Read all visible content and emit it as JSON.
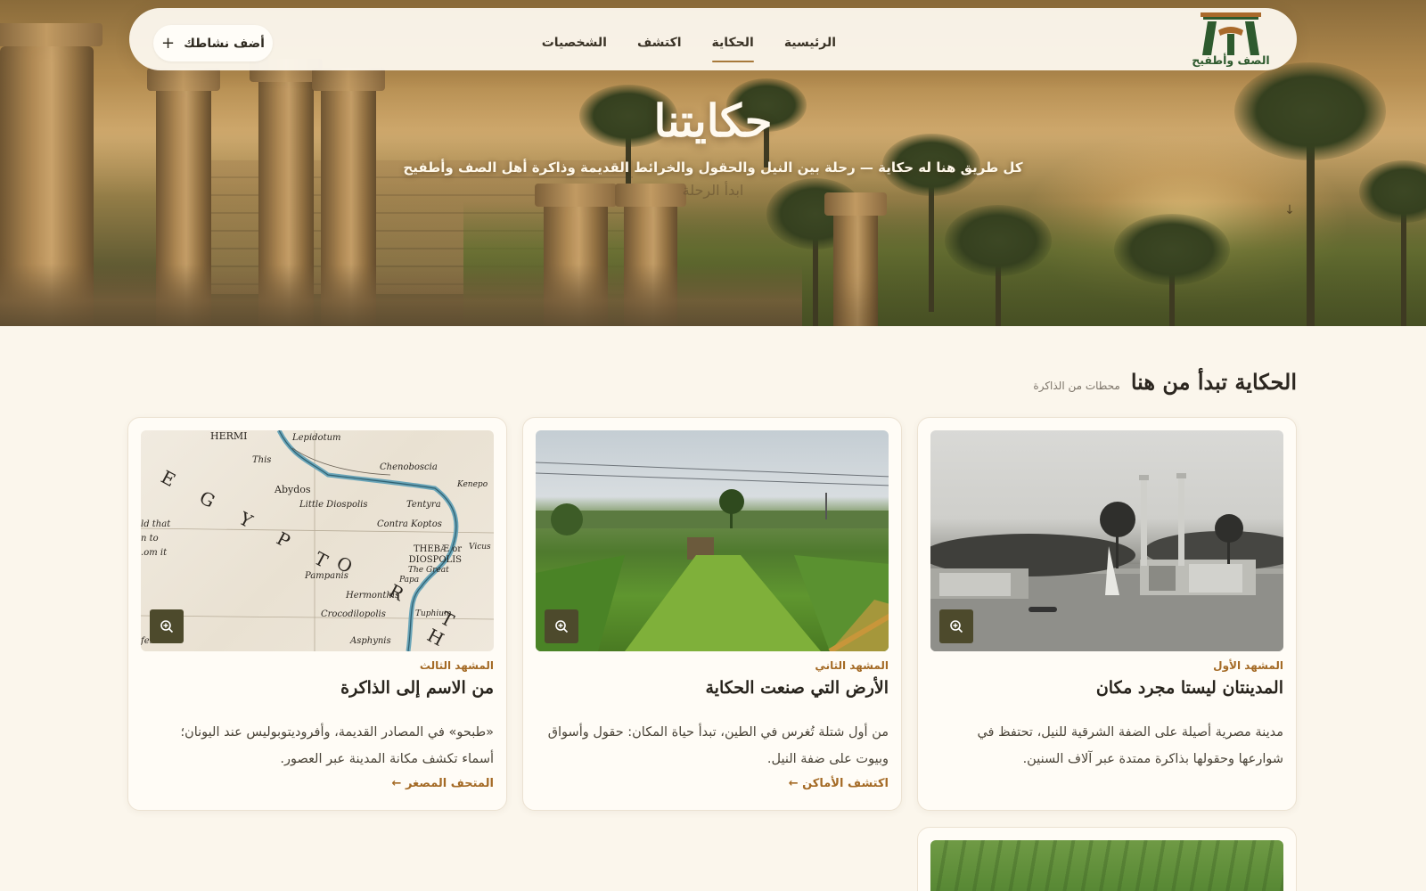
{
  "nav": {
    "logo_text": "الصف وأطفيح",
    "links": [
      {
        "label": "الرئيسية"
      },
      {
        "label": "الحكاية"
      },
      {
        "label": "اكتشف"
      },
      {
        "label": "الشخصيات"
      }
    ],
    "active_index": 1,
    "add_button": "أضف نشاطك"
  },
  "hero": {
    "title": "حكايتنا",
    "subtitle": "كل طريق هنا له حكاية — رحلة بين النيل والحقول والخرائط القديمة وذاكرة أهل الصف وأطفيح",
    "cta": "ابدأ الرحلة"
  },
  "section": {
    "title": "الحكاية تبدأ من هنا",
    "subtitle": "محطات من الذاكرة"
  },
  "cards": [
    {
      "kicker": "المشهد الأول",
      "title": "المدينتان ليستا مجرد مكان",
      "description": "مدينة مصرية أصيلة على الضفة الشرقية للنيل، تحتفظ في شوارعها وحقولها بذاكرة ممتدة عبر آلاف السنين.",
      "link": ""
    },
    {
      "kicker": "المشهد الثاني",
      "title": "الأرض التي صنعت الحكاية",
      "description": "من أول شتلة تُغرس في الطين، تبدأ حياة المكان: حقول وأسواق وبيوت على ضفة النيل.",
      "link": "اكتشف الأماكن ←"
    },
    {
      "kicker": "المشهد الثالث",
      "title": "من الاسم إلى الذاكرة",
      "description": "«طبحو» في المصادر القديمة، وأفروديتوبوليس عند اليونان؛ أسماء تكشف مكانة المدينة عبر العصور.",
      "link": "المتحف المصغر ←"
    }
  ],
  "map_labels": {
    "egypt": "E G Y P T",
    "north": "O R T H",
    "thebes": "THEBÆ or DIOSPOLIS",
    "thebes2": "The Great",
    "abydos": "Abydos",
    "lepidotum": "Lepidotum",
    "chenoboscia": "Chenoboscia",
    "little_diospolis": "Little Diospolis",
    "tentyra": "Tentyra",
    "contra_koptos": "Contra Koptos",
    "hermonthis": "Hermonthis",
    "crocodilopolis": "Crocodilopolis",
    "pampanis": "Pampanis",
    "papa": "Papa",
    "tuphium": "Tuphium",
    "asphynis": "Asphynis",
    "hermi": "HERMI",
    "this": "This",
    "kenepo": "Kenepo",
    "vicus": "Vicus",
    "left1": "ld that",
    "left2": "n to",
    "left3": "om it.",
    "left4": "ferod"
  },
  "colors": {
    "accent": "#a46a25",
    "zoom_bg": "#4d4a2c",
    "page_bg": "#fbf6ec"
  },
  "icons": {
    "zoom": "zoom-in-icon",
    "add": "plus-icon",
    "scroll": "arrow-down-icon"
  }
}
